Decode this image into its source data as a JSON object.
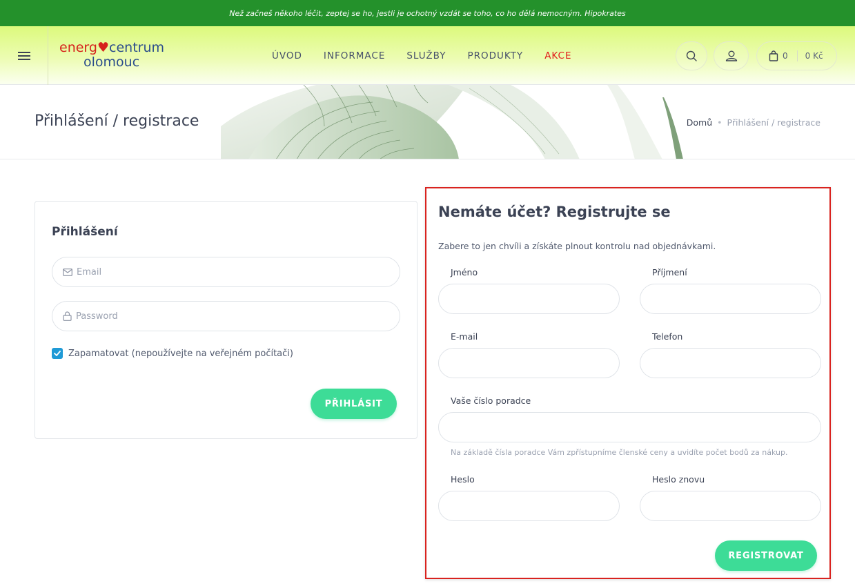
{
  "banner": {
    "text": "Než začneš někoho léčit, zeptej se ho, jestli je ochotný vzdát se toho, co ho dělá nemocným. Hipokrates"
  },
  "logo": {
    "part1": "energ",
    "heart": "♥",
    "part2": "centrum",
    "line2": "olomouc"
  },
  "nav": {
    "items": [
      "ÚVOD",
      "INFORMACE",
      "SLUŽBY",
      "PRODUKTY",
      "AKCE"
    ]
  },
  "cart": {
    "count": "0",
    "total": "0 Kč"
  },
  "page": {
    "title": "Přihlášení / registrace"
  },
  "breadcrumb": {
    "home": "Domů",
    "separator": "•",
    "current": "Přihlášení / registrace"
  },
  "login": {
    "title": "Přihlášení",
    "email_placeholder": "Email",
    "password_placeholder": "Password",
    "remember_label": "Zapamatovat (nepoužívejte na veřejném počítači)",
    "submit_label": "PŘIHLÁSIT"
  },
  "register": {
    "title": "Nemáte účet? Registrujte se",
    "subtitle": "Zabere to jen chvíli a získáte plnout kontrolu nad objednávkami.",
    "first_name_label": "Jméno",
    "last_name_label": "Příjmení",
    "email_label": "E-mail",
    "phone_label": "Telefon",
    "advisor_label": "Vaše číslo poradce",
    "advisor_hint": "Na základě čísla poradce Vám zpřístupníme členské ceny a uvidíte počet bodů za nákup.",
    "password_label": "Heslo",
    "password_again_label": "Heslo znovu",
    "submit_label": "REGISTROVAT"
  },
  "colors": {
    "banner": "#24912b",
    "accent_button": "#3ddc97",
    "highlight_border": "#d9231f",
    "nav_akce": "#e11a1a",
    "checkbox": "#1f9ad6"
  }
}
